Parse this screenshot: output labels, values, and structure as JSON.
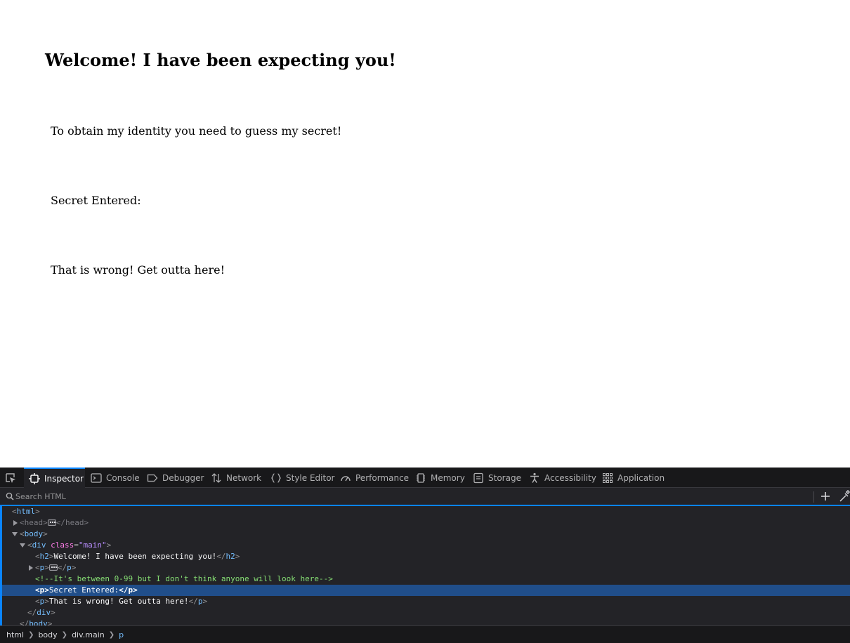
{
  "page": {
    "heading": "Welcome! I have been expecting you!",
    "paragraphs": [
      "To obtain my identity you need to guess my secret!",
      "Secret Entered:",
      "That is wrong! Get outta here!"
    ]
  },
  "devtools": {
    "tabs": [
      {
        "label": "Inspector",
        "icon": "inspector-icon",
        "active": true
      },
      {
        "label": "Console",
        "icon": "console-icon"
      },
      {
        "label": "Debugger",
        "icon": "debugger-icon"
      },
      {
        "label": "Network",
        "icon": "network-icon"
      },
      {
        "label": "Style Editor",
        "icon": "style-editor-icon"
      },
      {
        "label": "Performance",
        "icon": "performance-icon"
      },
      {
        "label": "Memory",
        "icon": "memory-icon"
      },
      {
        "label": "Storage",
        "icon": "storage-icon"
      },
      {
        "label": "Accessibility",
        "icon": "accessibility-icon"
      },
      {
        "label": "Application",
        "icon": "application-icon"
      }
    ],
    "search": {
      "placeholder": "Search HTML"
    },
    "markup": {
      "html_open": {
        "lt": "<",
        "tag": "html",
        "gt": ">"
      },
      "head": {
        "lt": "<",
        "tag": "head",
        "gt": ">",
        "close_lt": "</",
        "close_tag": "head",
        "close_gt": ">"
      },
      "body_open": {
        "lt": "<",
        "tag": "body",
        "gt": ">"
      },
      "div_open": {
        "lt": "<",
        "tag": "div",
        "attr_name": "class",
        "eq": "=",
        "attr_value": "\"main\"",
        "gt": ">"
      },
      "h2": {
        "lt": "<",
        "tag": "h2",
        "gt": ">",
        "text": "Welcome! I have been expecting you!",
        "close_lt": "</",
        "close_tag": "h2",
        "close_gt": ">"
      },
      "p_collapsed": {
        "lt": "<",
        "tag": "p",
        "gt": ">",
        "close_lt": "</",
        "close_tag": "p",
        "close_gt": ">"
      },
      "comment": "<!--It's between 0-99 but I don't think anyone will look here-->",
      "p_selected": {
        "lt": "<",
        "tag": "p",
        "gt": ">",
        "text": "Secret Entered:",
        "close_lt": "</",
        "close_tag": "p",
        "close_gt": ">"
      },
      "p_wrong": {
        "lt": "<",
        "tag": "p",
        "gt": ">",
        "text": "That is wrong! Get outta here!",
        "close_lt": "</",
        "close_tag": "p",
        "close_gt": ">"
      },
      "div_close": {
        "lt": "</",
        "tag": "div",
        "gt": ">"
      },
      "body_close": {
        "lt": "</",
        "tag": "body",
        "gt": ">"
      }
    },
    "breadcrumbs": [
      "html",
      "body",
      "div.main",
      "p"
    ],
    "colors": {
      "accent": "#0a84ff",
      "selection": "#204e8a",
      "tag": "#75bfff",
      "attr_name": "#ff7de9",
      "attr_value": "#b98eff",
      "comment": "#86de74"
    }
  }
}
